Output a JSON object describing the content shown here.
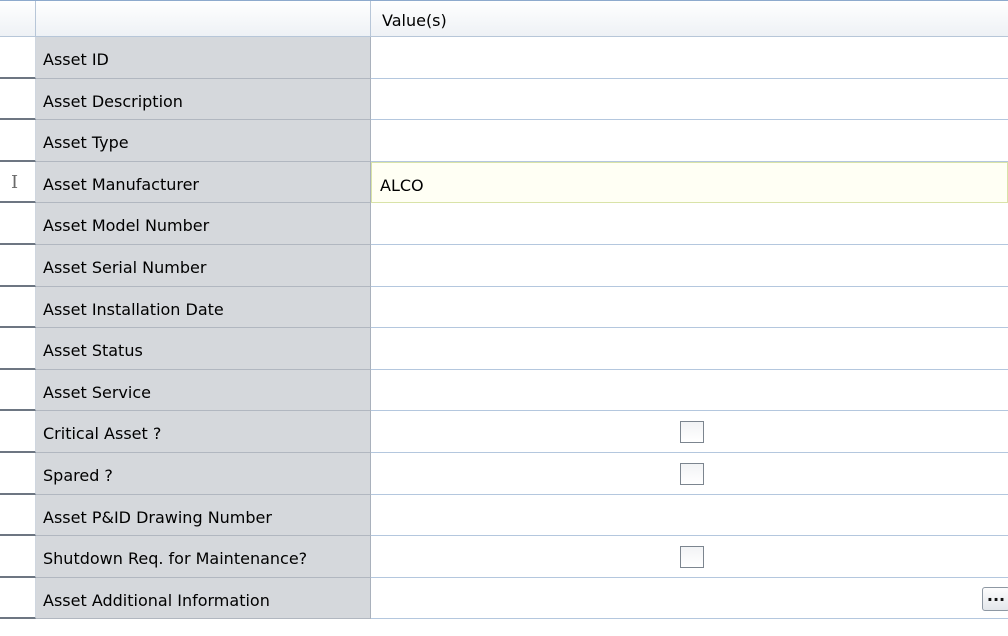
{
  "header": {
    "value_col_label": "Value(s)"
  },
  "rows": [
    {
      "label": "Asset ID",
      "value": ""
    },
    {
      "label": "Asset Description",
      "value": ""
    },
    {
      "label": "Asset Type",
      "value": ""
    },
    {
      "label": "Asset Manufacturer",
      "value": "ALCO",
      "active": true
    },
    {
      "label": "Asset Model Number",
      "value": ""
    },
    {
      "label": "Asset Serial Number",
      "value": ""
    },
    {
      "label": "Asset Installation Date",
      "value": ""
    },
    {
      "label": "Asset Status",
      "value": ""
    },
    {
      "label": "Asset Service",
      "value": ""
    },
    {
      "label": "Critical Asset ?",
      "value": "",
      "checkbox": true,
      "checked": false
    },
    {
      "label": "Spared ?",
      "value": "",
      "checkbox": true,
      "checked": false
    },
    {
      "label": "Asset P&ID Drawing Number",
      "value": ""
    },
    {
      "label": "Shutdown Req. for Maintenance?",
      "value": "",
      "checkbox": true,
      "checked": false
    },
    {
      "label": "Asset Additional Information",
      "value": "",
      "ellipsis": "..."
    }
  ],
  "icons": {
    "row_cursor": "text-cursor-icon"
  }
}
